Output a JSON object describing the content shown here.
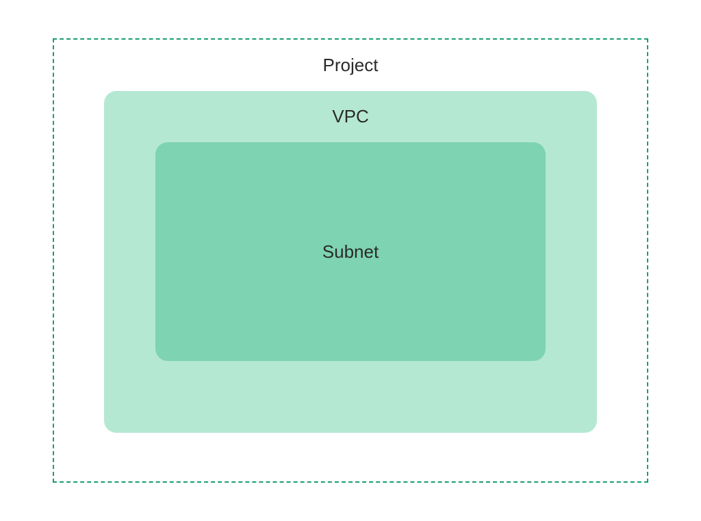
{
  "diagram": {
    "outer": {
      "label": "Project",
      "border_style": "dashed",
      "border_color": "#1a9e6e",
      "background": "#ffffff"
    },
    "middle": {
      "label": "VPC",
      "background": "#b5e8d3"
    },
    "inner": {
      "label": "Subnet",
      "background": "#7ed3b2"
    }
  }
}
